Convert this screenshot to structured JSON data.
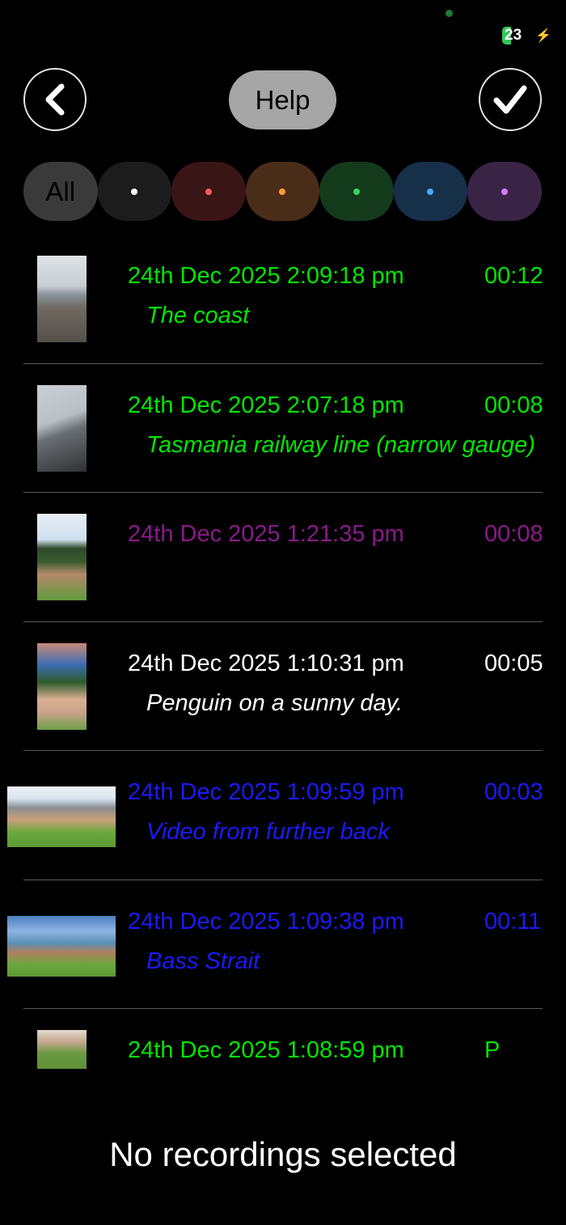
{
  "status": {
    "battery": "23"
  },
  "header": {
    "help_label": "Help"
  },
  "filters": [
    {
      "label": "All",
      "bg": "#3a3a3a"
    },
    {
      "label": "",
      "bg": "#1c1c1c",
      "dot": "#ffffff"
    },
    {
      "label": "",
      "bg": "#3a1516",
      "dot": "#ff5a5a"
    },
    {
      "label": "",
      "bg": "#4a2d18",
      "dot": "#ff9a3c"
    },
    {
      "label": "",
      "bg": "#143a1c",
      "dot": "#39d35a"
    },
    {
      "label": "",
      "bg": "#16304a",
      "dot": "#4aa8ff"
    },
    {
      "label": "",
      "bg": "#3a2446",
      "dot": "#d57cff"
    }
  ],
  "recordings": [
    {
      "date": "24th Dec 2025 2:09:18 pm",
      "duration": "00:12",
      "note": "The coast",
      "color": "#00e600",
      "thumb": "portrait-coast"
    },
    {
      "date": "24th Dec 2025 2:07:18 pm",
      "duration": "00:08",
      "note": "Tasmania railway line (narrow gauge)",
      "color": "#00e600",
      "thumb": "portrait-rail"
    },
    {
      "date": "24th Dec 2025 1:21:35 pm",
      "duration": "00:08",
      "note": "",
      "color": "#8a1a8a",
      "thumb": "portrait-park"
    },
    {
      "date": "24th Dec 2025 1:10:31 pm",
      "duration": "00:05",
      "note": "Penguin on a sunny day.",
      "color": "#ffffff",
      "thumb": "portrait-penguin"
    },
    {
      "date": "24th Dec 2025 1:09:59 pm",
      "duration": "00:03",
      "note": "Video from further back",
      "color": "#1a1aff",
      "thumb": "landscape-park"
    },
    {
      "date": "24th Dec 2025 1:09:38 pm",
      "duration": "00:11",
      "note": "Bass Strait",
      "color": "#1a1aff",
      "thumb": "landscape-strait"
    },
    {
      "date": "24th Dec 2025 1:08:59 pm",
      "duration": "P",
      "note": "",
      "color": "#00e600",
      "thumb": "small-grass"
    }
  ],
  "footer": {
    "message": "No recordings selected"
  }
}
